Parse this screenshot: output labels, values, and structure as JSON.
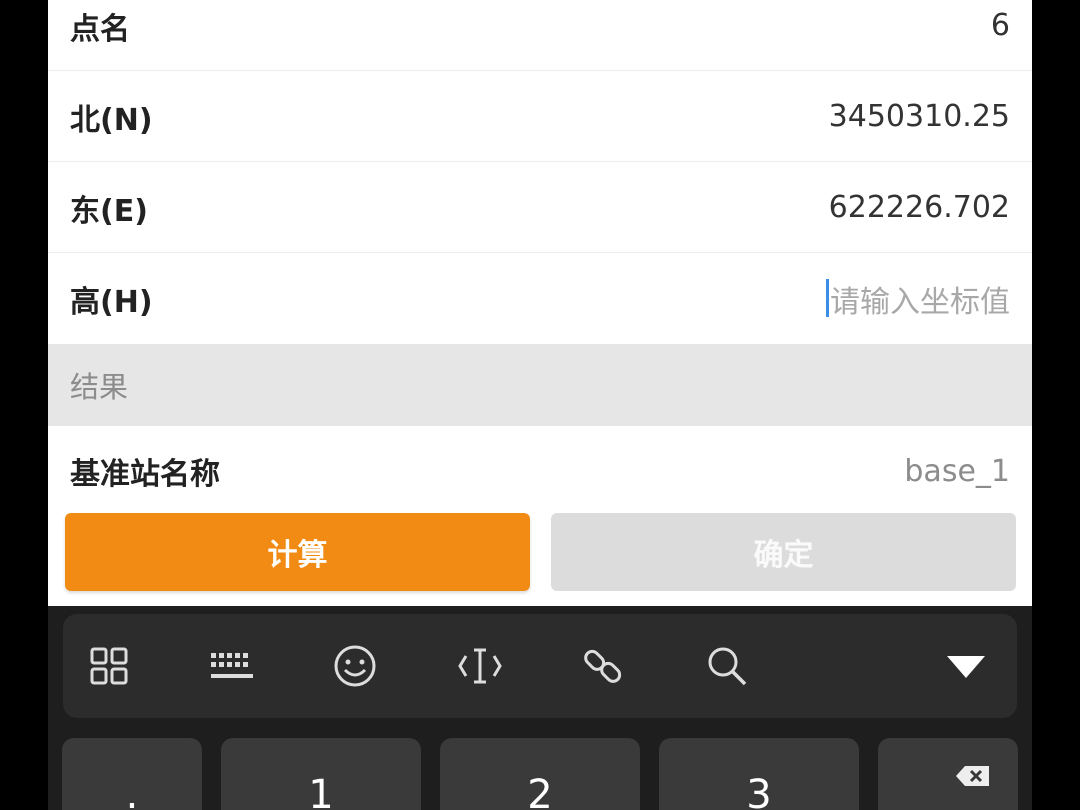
{
  "form": {
    "point_name": {
      "label": "点名",
      "value": "6"
    },
    "north": {
      "label": "北(N)",
      "value": "3450310.25"
    },
    "east": {
      "label": "东(E)",
      "value": "622226.702"
    },
    "height": {
      "label": "高(H)",
      "placeholder": "请输入坐标值"
    }
  },
  "result_section": {
    "title": "结果"
  },
  "base_station": {
    "label": "基准站名称",
    "value": "base_1"
  },
  "buttons": {
    "calculate": "计算",
    "confirm": "确定"
  },
  "keyboard": {
    "toolbar_icons": [
      "grid-icon",
      "keyboard-icon",
      "emoji-icon",
      "cursor-icon",
      "link-icon",
      "search-icon",
      "collapse-icon"
    ],
    "keys": {
      "punct": ".",
      "one": "1",
      "two": "2",
      "three": "3"
    }
  },
  "colors": {
    "accent": "#f28b14",
    "disabled": "#dcdcdc"
  }
}
